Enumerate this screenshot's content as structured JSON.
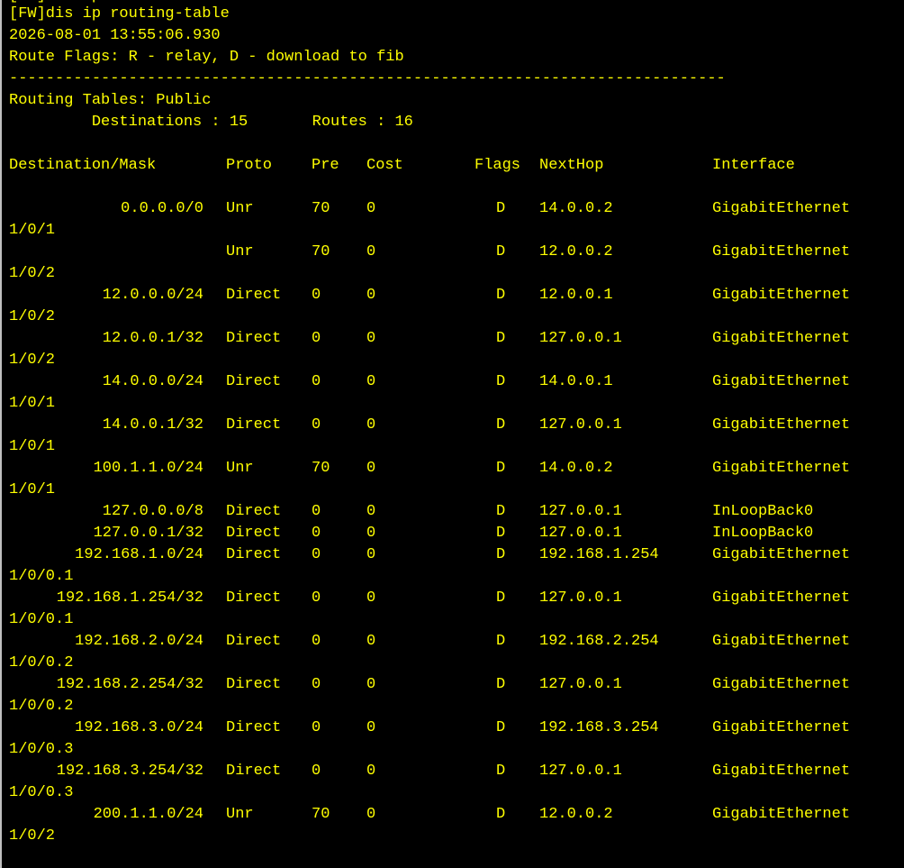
{
  "terminal": {
    "partial_top_line": "[FW]dis ip",
    "command_line": "[FW]dis ip routing-table",
    "timestamp": "2026-08-01 13:55:06.930",
    "route_flags": "Route Flags: R - relay, D - download to fib",
    "separator": "------------------------------------------------------------------------------",
    "routing_tables": "Routing Tables: Public",
    "summary": "         Destinations : 15       Routes : 16",
    "colors": {
      "background": "#000000",
      "text": "#ffff00"
    }
  },
  "table": {
    "headers": {
      "destination": "Destination/Mask",
      "proto": "Proto",
      "pre": "Pre",
      "cost": "Cost",
      "flags": "Flags",
      "nexthop": "NextHop",
      "interface": "Interface"
    },
    "rows": [
      {
        "dest": "0.0.0.0/0",
        "proto": "Unr",
        "pre": "70",
        "cost": "0",
        "flags": "D",
        "nexthop": "14.0.0.2",
        "iface": "GigabitEthernet",
        "wrap": "1/0/1"
      },
      {
        "dest": "",
        "proto": "Unr",
        "pre": "70",
        "cost": "0",
        "flags": "D",
        "nexthop": "12.0.0.2",
        "iface": "GigabitEthernet",
        "wrap": "1/0/2"
      },
      {
        "dest": "12.0.0.0/24",
        "proto": "Direct",
        "pre": "0",
        "cost": "0",
        "flags": "D",
        "nexthop": "12.0.0.1",
        "iface": "GigabitEthernet",
        "wrap": "1/0/2"
      },
      {
        "dest": "12.0.0.1/32",
        "proto": "Direct",
        "pre": "0",
        "cost": "0",
        "flags": "D",
        "nexthop": "127.0.0.1",
        "iface": "GigabitEthernet",
        "wrap": "1/0/2"
      },
      {
        "dest": "14.0.0.0/24",
        "proto": "Direct",
        "pre": "0",
        "cost": "0",
        "flags": "D",
        "nexthop": "14.0.0.1",
        "iface": "GigabitEthernet",
        "wrap": "1/0/1"
      },
      {
        "dest": "14.0.0.1/32",
        "proto": "Direct",
        "pre": "0",
        "cost": "0",
        "flags": "D",
        "nexthop": "127.0.0.1",
        "iface": "GigabitEthernet",
        "wrap": "1/0/1"
      },
      {
        "dest": "100.1.1.0/24",
        "proto": "Unr",
        "pre": "70",
        "cost": "0",
        "flags": "D",
        "nexthop": "14.0.0.2",
        "iface": "GigabitEthernet",
        "wrap": "1/0/1"
      },
      {
        "dest": "127.0.0.0/8",
        "proto": "Direct",
        "pre": "0",
        "cost": "0",
        "flags": "D",
        "nexthop": "127.0.0.1",
        "iface": "InLoopBack0",
        "wrap": ""
      },
      {
        "dest": "127.0.0.1/32",
        "proto": "Direct",
        "pre": "0",
        "cost": "0",
        "flags": "D",
        "nexthop": "127.0.0.1",
        "iface": "InLoopBack0",
        "wrap": ""
      },
      {
        "dest": "192.168.1.0/24",
        "proto": "Direct",
        "pre": "0",
        "cost": "0",
        "flags": "D",
        "nexthop": "192.168.1.254",
        "iface": "GigabitEthernet",
        "wrap": "1/0/0.1"
      },
      {
        "dest": "192.168.1.254/32",
        "proto": "Direct",
        "pre": "0",
        "cost": "0",
        "flags": "D",
        "nexthop": "127.0.0.1",
        "iface": "GigabitEthernet",
        "wrap": "1/0/0.1"
      },
      {
        "dest": "192.168.2.0/24",
        "proto": "Direct",
        "pre": "0",
        "cost": "0",
        "flags": "D",
        "nexthop": "192.168.2.254",
        "iface": "GigabitEthernet",
        "wrap": "1/0/0.2"
      },
      {
        "dest": "192.168.2.254/32",
        "proto": "Direct",
        "pre": "0",
        "cost": "0",
        "flags": "D",
        "nexthop": "127.0.0.1",
        "iface": "GigabitEthernet",
        "wrap": "1/0/0.2"
      },
      {
        "dest": "192.168.3.0/24",
        "proto": "Direct",
        "pre": "0",
        "cost": "0",
        "flags": "D",
        "nexthop": "192.168.3.254",
        "iface": "GigabitEthernet",
        "wrap": "1/0/0.3"
      },
      {
        "dest": "192.168.3.254/32",
        "proto": "Direct",
        "pre": "0",
        "cost": "0",
        "flags": "D",
        "nexthop": "127.0.0.1",
        "iface": "GigabitEthernet",
        "wrap": "1/0/0.3"
      },
      {
        "dest": "200.1.1.0/24",
        "proto": "Unr",
        "pre": "70",
        "cost": "0",
        "flags": "D",
        "nexthop": "12.0.0.2",
        "iface": "GigabitEthernet",
        "wrap": "1/0/2"
      }
    ]
  }
}
